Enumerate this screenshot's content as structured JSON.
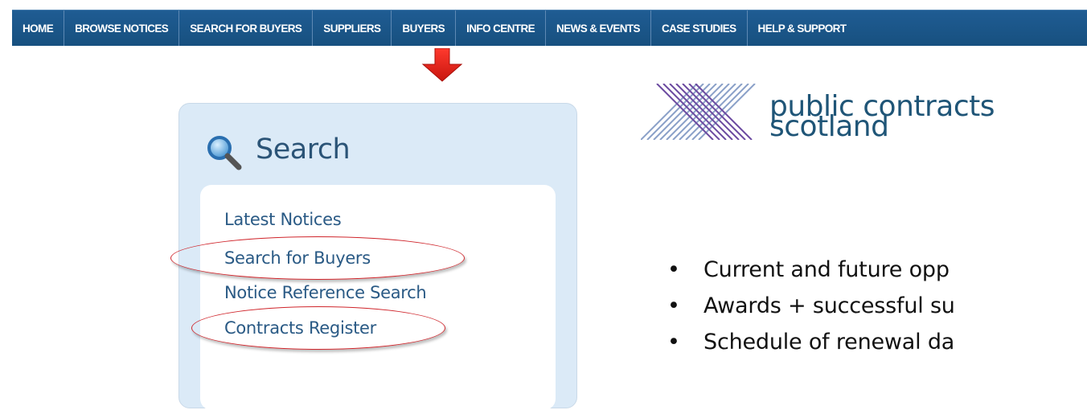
{
  "nav": {
    "items": [
      "HOME",
      "BROWSE NOTICES",
      "SEARCH FOR BUYERS",
      "SUPPLIERS",
      "BUYERS",
      "INFO CENTRE",
      "NEWS & EVENTS",
      "CASE STUDIES",
      "HELP & SUPPORT"
    ],
    "highlighted": "SUPPLIERS"
  },
  "search_panel": {
    "title": "Search",
    "links": [
      "Latest Notices",
      "Search for Buyers",
      "Notice Reference Search",
      "Contracts Register"
    ],
    "circled_links": [
      "Search for Buyers",
      "Contracts Register"
    ]
  },
  "logo": {
    "line1": "public contracts",
    "line2": "scotland"
  },
  "bullets": [
    "Current and future opp",
    "Awards + successful su",
    "Schedule of renewal da"
  ],
  "colors": {
    "nav_bg": "#17507f",
    "panel_bg": "#dbeaf7",
    "link": "#2a5a85",
    "annotation_red": "#d0262c"
  }
}
